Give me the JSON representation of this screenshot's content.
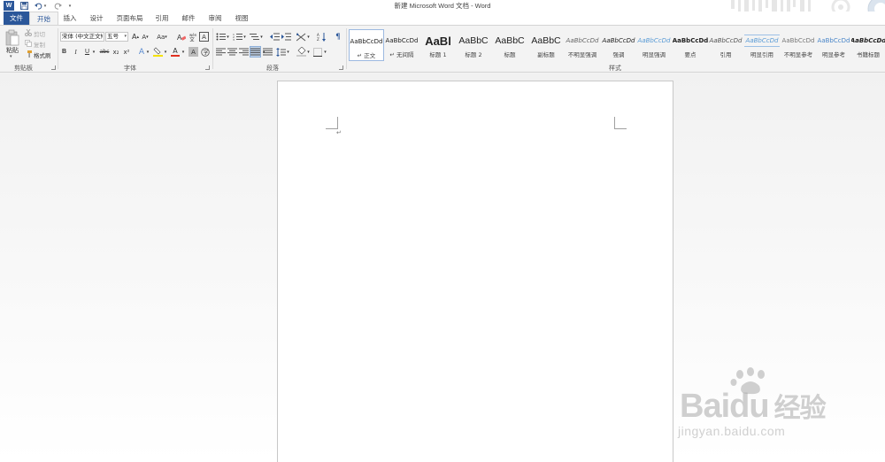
{
  "title_bar": {
    "logo": "W",
    "save_icon": "save-icon",
    "undo_icon": "undo-icon",
    "redo_icon": "redo-icon",
    "title": "新建 Microsoft Word 文档 - Word"
  },
  "tabs": [
    "文件",
    "开始",
    "插入",
    "设计",
    "页面布局",
    "引用",
    "邮件",
    "审阅",
    "视图"
  ],
  "active_tab": "开始",
  "clipboard": {
    "paste": "粘贴",
    "cut": "剪切",
    "copy": "复制",
    "format_painter": "格式刷",
    "label": "剪贴板"
  },
  "font": {
    "name": "宋体 (中文正文)",
    "size": "五号",
    "grow": "A",
    "shrink": "A",
    "change_case": "Aa",
    "bold": "B",
    "italic": "I",
    "underline": "U",
    "strike": "abc",
    "subscript": "x₂",
    "superscript": "x²",
    "char_border": "A",
    "char_shading": "A",
    "font_color": "A",
    "text_effect": "A",
    "label": "字体"
  },
  "paragraph": {
    "label": "段落"
  },
  "styles": {
    "label": "样式",
    "items": [
      {
        "sample": "AaBbCcDd",
        "name": "↵ 正文"
      },
      {
        "sample": "AaBbCcDd",
        "name": "↵ 无间隔"
      },
      {
        "sample": "AaBl",
        "name": "标题 1"
      },
      {
        "sample": "AaBbC",
        "name": "标题 2"
      },
      {
        "sample": "AaBbC",
        "name": "标题"
      },
      {
        "sample": "AaBbC",
        "name": "副标题"
      },
      {
        "sample": "AaBbCcDd",
        "name": "不明显强调"
      },
      {
        "sample": "AaBbCcDd",
        "name": "强调"
      },
      {
        "sample": "AaBbCcDd",
        "name": "明显强调"
      },
      {
        "sample": "AaBbCcDd",
        "name": "要点"
      },
      {
        "sample": "AaBbCcDd",
        "name": "引用"
      },
      {
        "sample": "AaBbCcDd",
        "name": "明显引用"
      },
      {
        "sample": "AaBbCcDd",
        "name": "不明显参考"
      },
      {
        "sample": "AaBbCcDd",
        "name": "明显参考"
      },
      {
        "sample": "AaBbCcDd",
        "name": "书籍标题"
      }
    ]
  },
  "document": {
    "paragraph_mark": "↵"
  },
  "watermark": {
    "brand": "Bai",
    "brand_2": "du",
    "brand_cn": "经验",
    "url": "jingyan.baidu.com"
  },
  "colors": {
    "accent": "#2b579a",
    "highlight": "#f5e100",
    "font_color": "#e03020"
  }
}
